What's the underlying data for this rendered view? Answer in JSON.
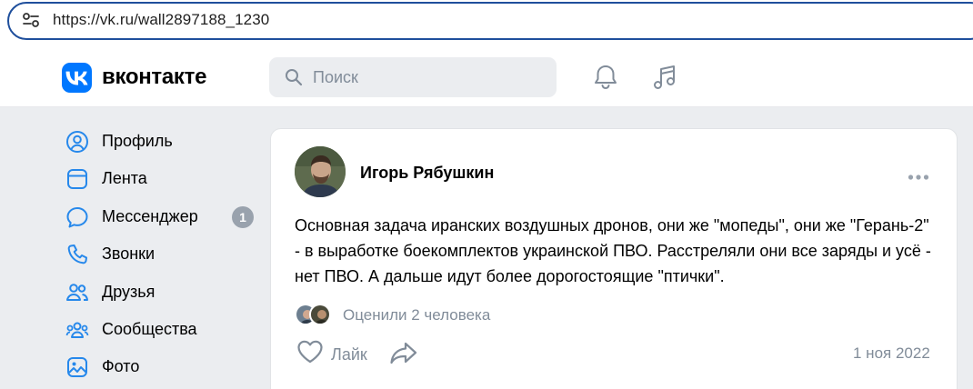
{
  "browser": {
    "url": "https://vk.ru/wall2897188_1230",
    "icons": [
      "site-info-icon"
    ]
  },
  "header": {
    "brand": "вконтакте",
    "search_placeholder": "Поиск",
    "icons": [
      "vk-logo-icon",
      "search-icon",
      "bell-icon",
      "music-icon"
    ]
  },
  "sidebar": {
    "items": [
      {
        "label": "Профиль",
        "icon": "profile-icon"
      },
      {
        "label": "Лента",
        "icon": "feed-icon"
      },
      {
        "label": "Мессенджер",
        "icon": "messenger-icon",
        "badge": "1"
      },
      {
        "label": "Звонки",
        "icon": "phone-icon"
      },
      {
        "label": "Друзья",
        "icon": "friends-icon"
      },
      {
        "label": "Сообщества",
        "icon": "communities-icon"
      },
      {
        "label": "Фото",
        "icon": "photo-icon"
      }
    ]
  },
  "post": {
    "author": "Игорь Рябушкин",
    "text": "Основная задача иранских воздушных дронов, они же \"мопеды\", они же \"Герань-2\" - в выработке боекомплектов украинской ПВО. Расстреляли они все заряды и усё - нет ПВО. А дальше идут более дорогостоящие \"птички\".",
    "likes_text": "Оценили 2 человека",
    "like_label": "Лайк",
    "date": "1 ноя 2022"
  },
  "colors": {
    "accent": "#0077ff",
    "background": "#ebedf0",
    "secondary_text": "#818c99",
    "badge": "#99a2ad",
    "icon_blue": "#2688eb",
    "url_border": "#1f4f9c"
  }
}
